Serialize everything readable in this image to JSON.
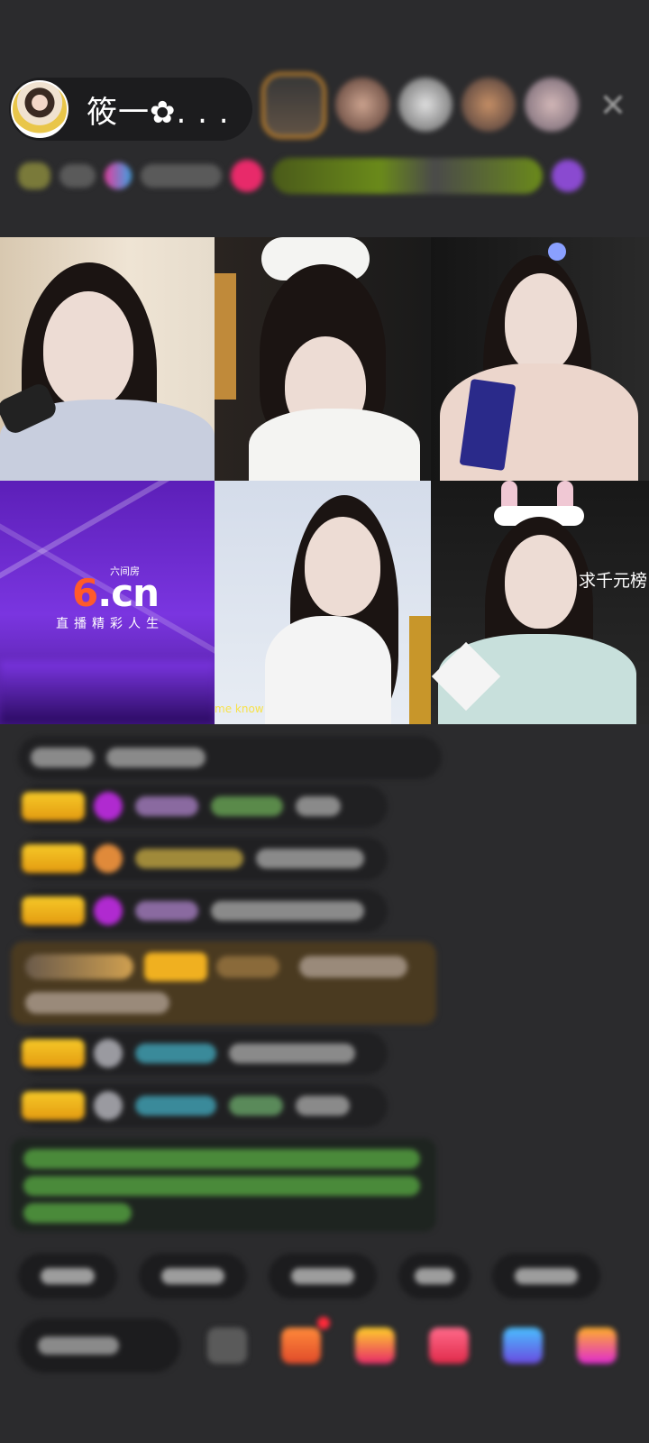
{
  "header": {
    "host_name": "筱一✿. . .",
    "close_icon": "close-icon"
  },
  "video_grid": {
    "tiles": [
      {
        "id": "streamer-1"
      },
      {
        "id": "streamer-2"
      },
      {
        "id": "streamer-3"
      },
      {
        "id": "brand-placeholder",
        "logo_text": "6.cn",
        "logo_small": "六间房",
        "slogan": "直播精彩人生"
      },
      {
        "id": "streamer-5",
        "caption": "me know"
      },
      {
        "id": "streamer-6",
        "overlay_text": "求千元榜"
      }
    ]
  },
  "colors": {
    "background": "#2b2b2d",
    "pill": "#1c1c1e",
    "gold_badge": "#f6c928",
    "brand_purple": "#6a2fd0",
    "brand_orange": "#ff5a2a"
  }
}
